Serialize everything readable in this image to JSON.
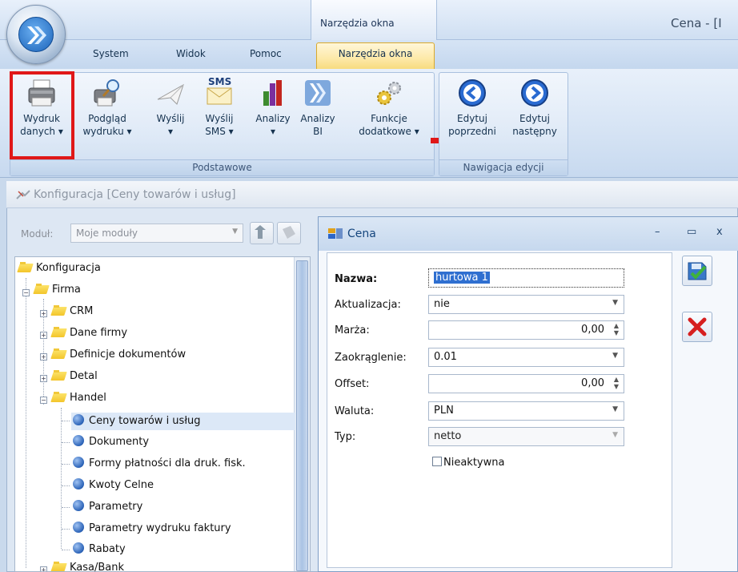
{
  "window": {
    "app_title": "Cena - [I",
    "context_title": "Narzędzia okna"
  },
  "tabs": [
    "System",
    "Widok",
    "Pomoc",
    "Narzędzia okna"
  ],
  "ribbon": {
    "groups": {
      "basic": "Podstawowe",
      "nav": "Nawigacja edycji"
    },
    "buttons": {
      "print": [
        "Wydruk",
        "danych ▾"
      ],
      "preview": [
        "Podgląd",
        "wydruku ▾"
      ],
      "send": [
        "Wyślij",
        "▾"
      ],
      "sms": [
        "Wyślij",
        "SMS ▾"
      ],
      "analyses": [
        "Analizy",
        "▾"
      ],
      "bi": [
        "Analizy",
        "BI"
      ],
      "extra": [
        "Funkcje",
        "dodatkowe ▾"
      ],
      "prev": [
        "Edytuj",
        "poprzedni"
      ],
      "next": [
        "Edytuj",
        "następny"
      ]
    },
    "sms_badge": "SMS"
  },
  "config_window": {
    "title": "Konfiguracja [Ceny towarów i usług]",
    "module_label": "Moduł:",
    "module_value": "Moje moduły",
    "tree": [
      "Konfiguracja",
      "Firma",
      "CRM",
      "Dane firmy",
      "Definicje dokumentów",
      "Detal",
      "Handel",
      "Ceny towarów i usług",
      "Dokumenty",
      "Formy płatności dla druk. fisk.",
      "Kwoty Celne",
      "Parametry",
      "Parametry wydruku faktury",
      "Rabaty",
      "Kasa/Bank"
    ]
  },
  "dialog": {
    "title": "Cena",
    "window_buttons": [
      "–",
      "▭",
      "x"
    ],
    "fields": {
      "nazwa_label": "Nazwa:",
      "nazwa_value": "hurtowa 1",
      "aktualizacja_label": "Aktualizacja:",
      "aktualizacja_value": "nie",
      "marza_label": "Marża:",
      "marza_value": "0,00",
      "zaokraglenie_label": "Zaokrąglenie:",
      "zaokraglenie_value": "0.01",
      "offset_label": "Offset:",
      "offset_value": "0,00",
      "waluta_label": "Waluta:",
      "waluta_value": "PLN",
      "typ_label": "Typ:",
      "typ_value": "netto"
    },
    "inactive_label": "Nieaktywna",
    "inactive_checked": false
  },
  "colors": {
    "accent_highlight": "#e01818",
    "active_tab": "#fde9a8",
    "selection": "#2f6fd0"
  }
}
